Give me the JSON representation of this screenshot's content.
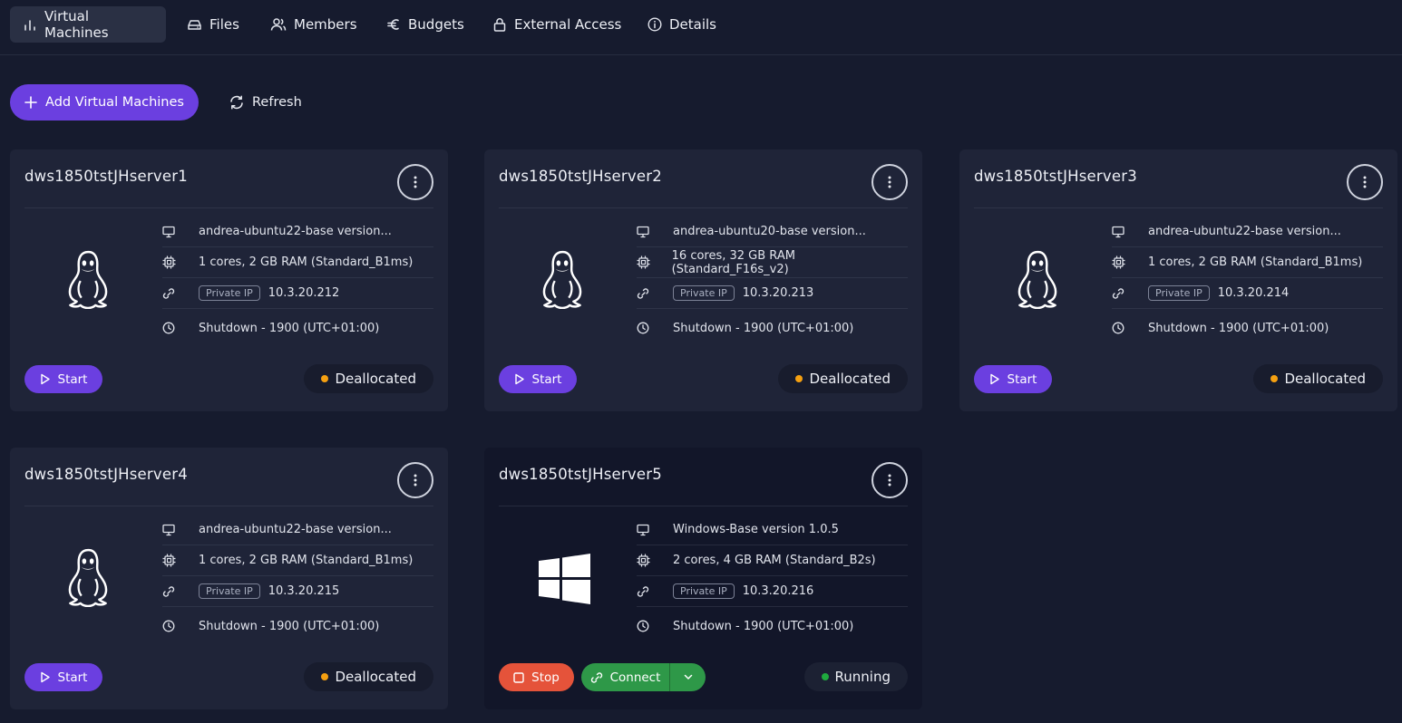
{
  "tabs": [
    {
      "label": "Virtual Machines",
      "icon": "bar-chart-icon",
      "active": true
    },
    {
      "label": "Files",
      "icon": "drive-icon"
    },
    {
      "label": "Members",
      "icon": "users-icon"
    },
    {
      "label": "Budgets",
      "icon": "euro-icon"
    },
    {
      "label": "External Access",
      "icon": "lock-icon"
    },
    {
      "label": "Details",
      "icon": "info-icon"
    }
  ],
  "toolbar": {
    "add_label": "Add Virtual Machines",
    "refresh_label": "Refresh"
  },
  "colors": {
    "accent": "#6b3fe0",
    "deallocated": "#f5a011",
    "running": "#1faa3e",
    "stop": "#e5533a",
    "connect": "#2e9848"
  },
  "labels": {
    "private_ip": "Private IP",
    "start": "Start",
    "stop": "Stop",
    "connect": "Connect"
  },
  "vms": [
    {
      "name": "dws1850tstJHserver1",
      "os": "linux",
      "image": "andrea-ubuntu22-base version...",
      "size": "1 cores, 2 GB RAM (Standard_B1ms)",
      "ip": "10.3.20.212",
      "schedule": "Shutdown -  1900  (UTC+01:00)",
      "status": "Deallocated"
    },
    {
      "name": "dws1850tstJHserver2",
      "os": "linux",
      "image": "andrea-ubuntu20-base version...",
      "size": "16 cores, 32 GB RAM (Standard_F16s_v2)",
      "ip": "10.3.20.213",
      "schedule": "Shutdown -  1900  (UTC+01:00)",
      "status": "Deallocated"
    },
    {
      "name": "dws1850tstJHserver3",
      "os": "linux",
      "image": "andrea-ubuntu22-base version...",
      "size": "1 cores, 2 GB RAM (Standard_B1ms)",
      "ip": "10.3.20.214",
      "schedule": "Shutdown -  1900  (UTC+01:00)",
      "status": "Deallocated"
    },
    {
      "name": "dws1850tstJHserver4",
      "os": "linux",
      "image": "andrea-ubuntu22-base version...",
      "size": "1 cores, 2 GB RAM (Standard_B1ms)",
      "ip": "10.3.20.215",
      "schedule": "Shutdown -  1900  (UTC+01:00)",
      "status": "Deallocated"
    },
    {
      "name": "dws1850tstJHserver5",
      "os": "windows",
      "image": "Windows-Base version 1.0.5",
      "size": "2 cores, 4 GB RAM (Standard_B2s)",
      "ip": "10.3.20.216",
      "schedule": "Shutdown -  1900  (UTC+01:00)",
      "status": "Running"
    }
  ]
}
